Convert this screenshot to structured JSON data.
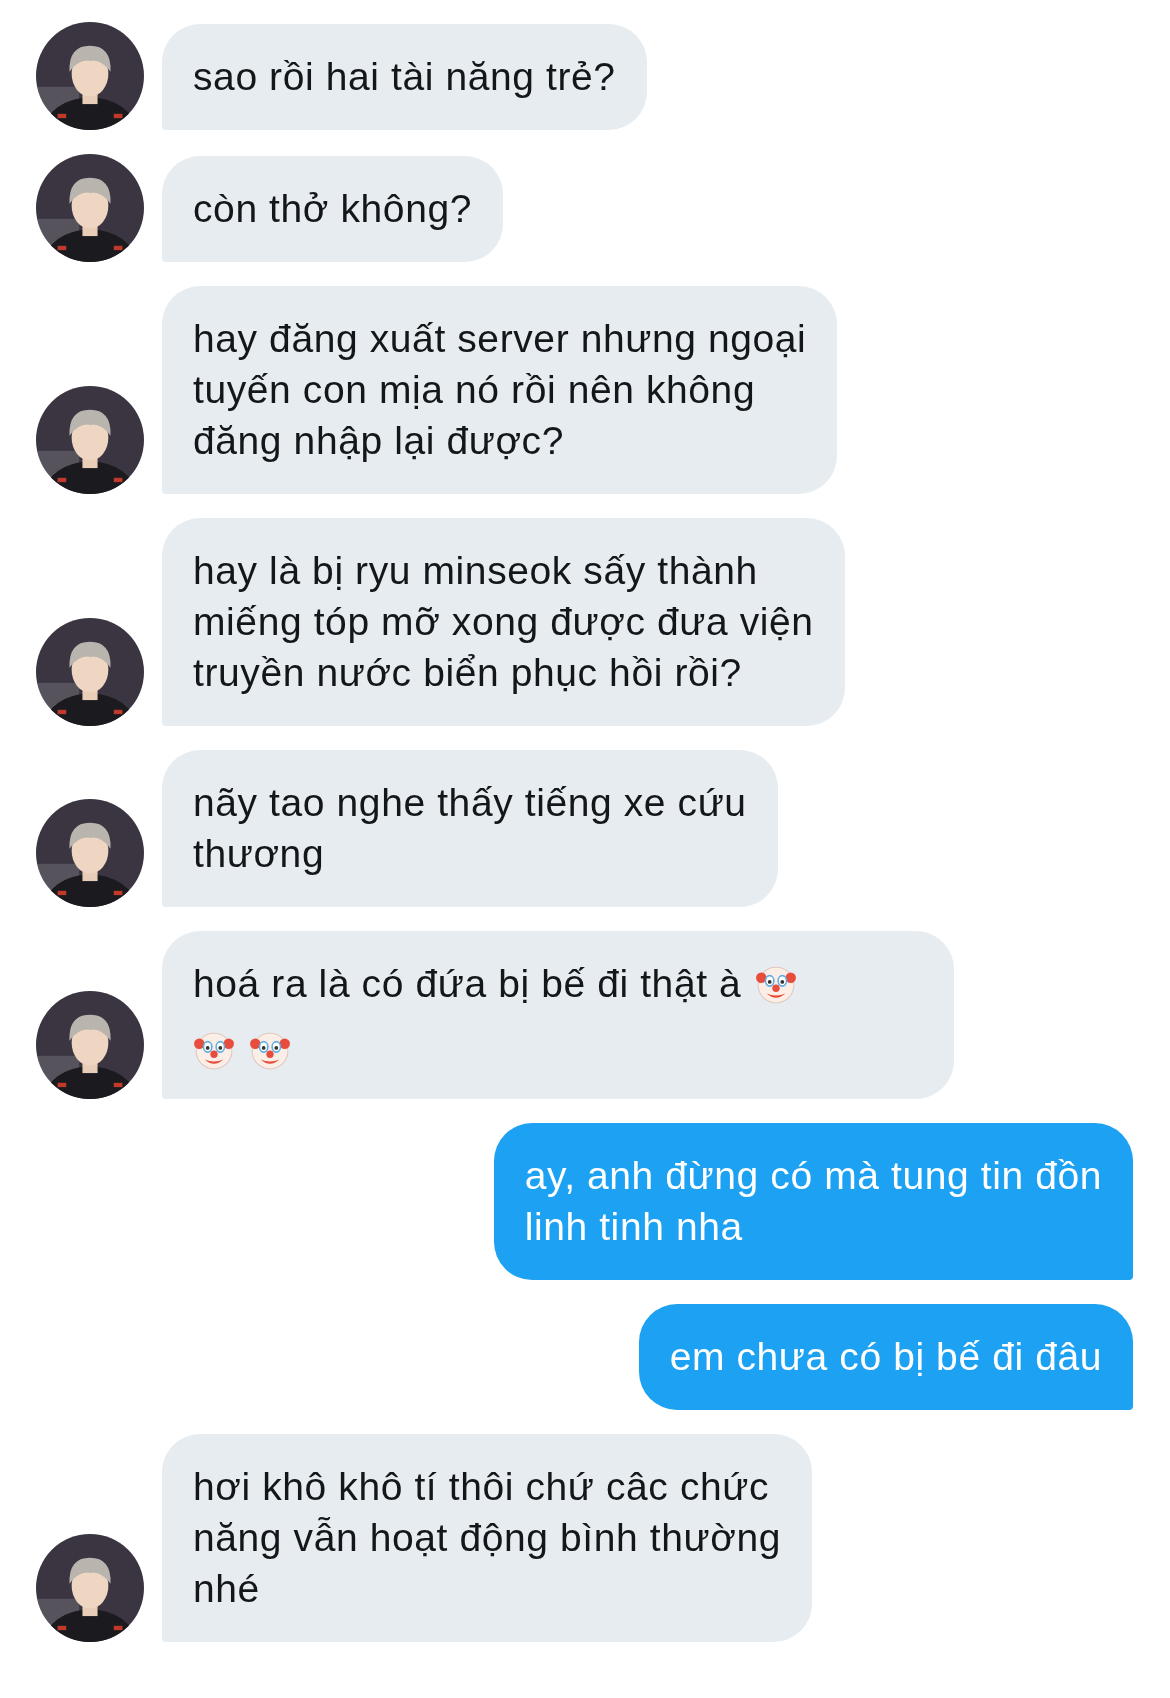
{
  "messages": [
    {
      "kind": "in",
      "parts": [
        {
          "kind": "text",
          "text": "sao rồi hai tài năng trẻ?"
        }
      ]
    },
    {
      "kind": "in",
      "parts": [
        {
          "kind": "text",
          "text": "còn thở không?"
        }
      ]
    },
    {
      "kind": "in",
      "parts": [
        {
          "kind": "text",
          "text": "hay đăng xuất server nhưng ngoại\ntuyến con mịa nó rồi nên không\nđăng nhập lại được?"
        }
      ]
    },
    {
      "kind": "in",
      "parts": [
        {
          "kind": "text",
          "text": "hay là bị ryu minseok sấy thành\nmiếng tóp mỡ xong được đưa viện\ntruyền nước biển phục hồi rồi?"
        }
      ]
    },
    {
      "kind": "in",
      "parts": [
        {
          "kind": "text",
          "text": "nãy tao nghe thấy tiếng xe cứu\nthương"
        }
      ]
    },
    {
      "kind": "in",
      "parts": [
        {
          "kind": "text",
          "text": "hoá ra là có đứa bị bế đi thật à"
        },
        {
          "kind": "clown"
        },
        {
          "kind": "break"
        },
        {
          "kind": "clown"
        },
        {
          "kind": "clown"
        }
      ]
    },
    {
      "kind": "out",
      "parts": [
        {
          "kind": "text",
          "text": "ay, anh đừng có mà tung tin đồn\nlinh tinh nha"
        }
      ]
    },
    {
      "kind": "out",
      "parts": [
        {
          "kind": "text",
          "text": "em chưa có bị bế đi đâu"
        }
      ]
    },
    {
      "kind": "in",
      "parts": [
        {
          "kind": "text",
          "text": "hơi khô khô tí thôi chứ câc chức\nnăng vẫn hoạt động bình thường\nnhé"
        }
      ]
    }
  ]
}
